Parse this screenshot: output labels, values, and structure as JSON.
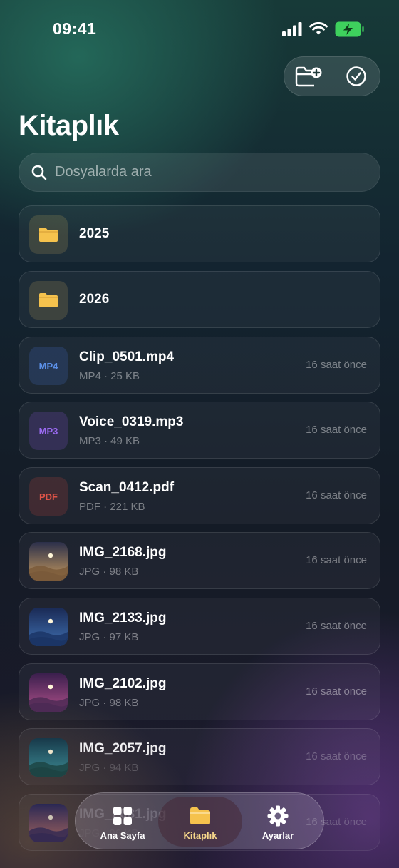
{
  "status_bar": {
    "time": "09:41",
    "icons": [
      "cellular-signal-icon",
      "wifi-icon",
      "battery-charging-icon"
    ]
  },
  "header": {
    "actions": [
      "new-folder-icon",
      "select-checkmark-icon"
    ],
    "title": "Kitaplık"
  },
  "search": {
    "placeholder": "Dosyalarda ara",
    "value": ""
  },
  "items": [
    {
      "kind": "folder",
      "name": "2025"
    },
    {
      "kind": "folder",
      "name": "2026"
    },
    {
      "kind": "mp4",
      "badge": "MP4",
      "name": "Clip_0501.mp4",
      "meta": "MP4 · 25 KB",
      "time": "16 saat önce"
    },
    {
      "kind": "mp3",
      "badge": "MP3",
      "name": "Voice_0319.mp3",
      "meta": "MP3 · 49 KB",
      "time": "16 saat önce"
    },
    {
      "kind": "pdf",
      "badge": "PDF",
      "name": "Scan_0412.pdf",
      "meta": "PDF · 221 KB",
      "time": "16 saat önce"
    },
    {
      "kind": "image",
      "name": "IMG_2168.jpg",
      "meta": "JPG · 98 KB",
      "time": "16 saat önce",
      "thumb_colors": [
        "#2b2f4a",
        "#c79a5e",
        "#7a5a3a"
      ]
    },
    {
      "kind": "image",
      "name": "IMG_2133.jpg",
      "meta": "JPG · 97 KB",
      "time": "16 saat önce",
      "thumb_colors": [
        "#1a2a55",
        "#3f6fb0",
        "#1b3566"
      ]
    },
    {
      "kind": "image",
      "name": "IMG_2102.jpg",
      "meta": "JPG · 98 KB",
      "time": "16 saat önce",
      "thumb_colors": [
        "#3a1f4d",
        "#b0508a",
        "#4d2a55"
      ]
    },
    {
      "kind": "image",
      "name": "IMG_2057.jpg",
      "meta": "JPG · 94 KB",
      "time": "16 saat önce",
      "thumb_colors": [
        "#163a4a",
        "#3f9aa0",
        "#1b4a45"
      ]
    },
    {
      "kind": "image",
      "name": "IMG_2031.jpg",
      "meta": "JPG · 96 KB",
      "time": "16 saat önce",
      "thumb_colors": [
        "#2a2a5a",
        "#c77a6a",
        "#3a2f5a"
      ]
    }
  ],
  "tabbar": {
    "tabs": [
      {
        "label": "Ana Sayfa",
        "icon": "grid-icon",
        "active": false
      },
      {
        "label": "Kitaplık",
        "icon": "folder-icon",
        "active": true
      },
      {
        "label": "Ayarlar",
        "icon": "gear-icon",
        "active": false
      }
    ]
  },
  "colors": {
    "folder_accent": "#f5c24d",
    "mp4": "#5b8fe6",
    "mp3": "#9a6af0",
    "pdf": "#e05448",
    "active_tab_label": "#f5d68a"
  }
}
